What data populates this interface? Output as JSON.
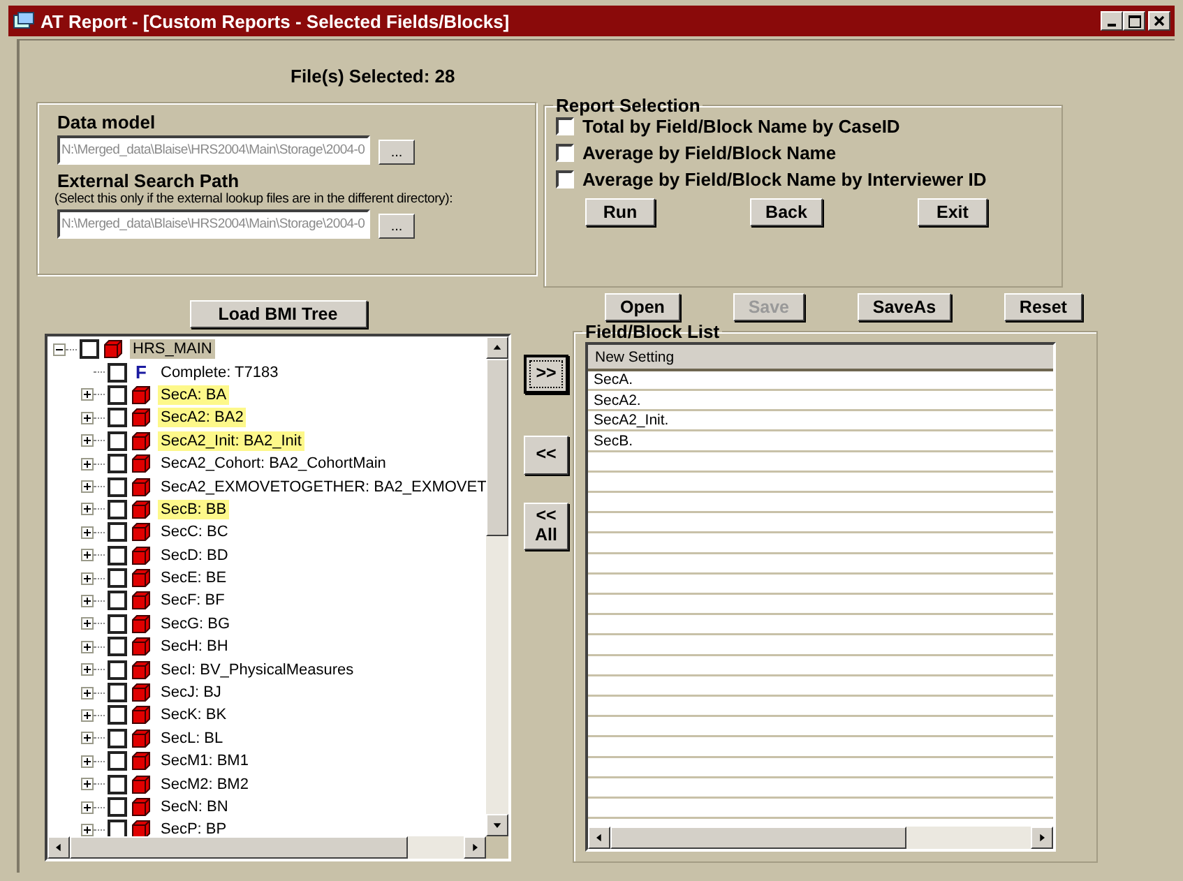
{
  "window": {
    "title": "AT Report - [Custom Reports - Selected Fields/Blocks]"
  },
  "files_selected": "File(s) Selected: 28",
  "data_model": {
    "label": "Data model",
    "value": "N:\\Merged_data\\Blaise\\HRS2004\\Main\\Storage\\2004-0",
    "browse": "..."
  },
  "external_search_path": {
    "label": "External Search Path",
    "note": "(Select this only if the external lookup files are in the different directory):",
    "value": "N:\\Merged_data\\Blaise\\HRS2004\\Main\\Storage\\2004-0",
    "browse": "..."
  },
  "report_selection": {
    "title": "Report Selection",
    "options": [
      {
        "label": "Total by Field/Block Name by CaseID",
        "checked": false
      },
      {
        "label": "Average by Field/Block Name",
        "checked": false
      },
      {
        "label": "Average by Field/Block Name by Interviewer ID",
        "checked": false
      }
    ],
    "buttons": [
      {
        "label": "Run",
        "disabled": false
      },
      {
        "label": "Back",
        "disabled": false
      },
      {
        "label": "Exit",
        "disabled": false
      }
    ]
  },
  "load_button": "Load BMI Tree",
  "tree": {
    "root": {
      "label": "HRS_MAIN",
      "kind": "block",
      "checked": false,
      "expanded": true,
      "selected": true,
      "highlighted": false,
      "children": [
        {
          "label": "Complete: T7183",
          "kind": "field",
          "glyph": "F",
          "checked": false,
          "selected": false,
          "highlighted": false
        },
        {
          "label": "SecA: BA",
          "kind": "block",
          "checked": false,
          "expanded": false,
          "selected": false,
          "highlighted": true
        },
        {
          "label": "SecA2: BA2",
          "kind": "block",
          "checked": false,
          "expanded": false,
          "selected": false,
          "highlighted": true
        },
        {
          "label": "SecA2_Init: BA2_Init",
          "kind": "block",
          "checked": false,
          "expanded": false,
          "selected": false,
          "highlighted": true
        },
        {
          "label": "SecA2_Cohort: BA2_CohortMain",
          "kind": "block",
          "checked": false,
          "expanded": false,
          "selected": false,
          "highlighted": false
        },
        {
          "label": "SecA2_EXMOVETOGETHER: BA2_EXMOVET",
          "kind": "block",
          "checked": false,
          "expanded": false,
          "selected": false,
          "highlighted": false
        },
        {
          "label": "SecB: BB",
          "kind": "block",
          "checked": false,
          "expanded": false,
          "selected": false,
          "highlighted": true
        },
        {
          "label": "SecC: BC",
          "kind": "block",
          "checked": false,
          "expanded": false,
          "selected": false,
          "highlighted": false
        },
        {
          "label": "SecD: BD",
          "kind": "block",
          "checked": false,
          "expanded": false,
          "selected": false,
          "highlighted": false
        },
        {
          "label": "SecE: BE",
          "kind": "block",
          "checked": false,
          "expanded": false,
          "selected": false,
          "highlighted": false
        },
        {
          "label": "SecF: BF",
          "kind": "block",
          "checked": false,
          "expanded": false,
          "selected": false,
          "highlighted": false
        },
        {
          "label": "SecG: BG",
          "kind": "block",
          "checked": false,
          "expanded": false,
          "selected": false,
          "highlighted": false
        },
        {
          "label": "SecH: BH",
          "kind": "block",
          "checked": false,
          "expanded": false,
          "selected": false,
          "highlighted": false
        },
        {
          "label": "SecI: BV_PhysicalMeasures",
          "kind": "block",
          "checked": false,
          "expanded": false,
          "selected": false,
          "highlighted": false
        },
        {
          "label": "SecJ: BJ",
          "kind": "block",
          "checked": false,
          "expanded": false,
          "selected": false,
          "highlighted": false
        },
        {
          "label": "SecK: BK",
          "kind": "block",
          "checked": false,
          "expanded": false,
          "selected": false,
          "highlighted": false
        },
        {
          "label": "SecL: BL",
          "kind": "block",
          "checked": false,
          "expanded": false,
          "selected": false,
          "highlighted": false
        },
        {
          "label": "SecM1: BM1",
          "kind": "block",
          "checked": false,
          "expanded": false,
          "selected": false,
          "highlighted": false
        },
        {
          "label": "SecM2: BM2",
          "kind": "block",
          "checked": false,
          "expanded": false,
          "selected": false,
          "highlighted": false
        },
        {
          "label": "SecN: BN",
          "kind": "block",
          "checked": false,
          "expanded": false,
          "selected": false,
          "highlighted": false
        },
        {
          "label": "SecP: BP",
          "kind": "block",
          "checked": false,
          "expanded": false,
          "selected": false,
          "highlighted": false
        }
      ]
    }
  },
  "transfer_buttons": [
    {
      "label": ">>",
      "focused": true
    },
    {
      "label": "<<",
      "focused": false
    },
    {
      "label": "<< All",
      "focused": false
    }
  ],
  "list_buttons": [
    {
      "label": "Open",
      "disabled": false
    },
    {
      "label": "Save",
      "disabled": true
    },
    {
      "label": "SaveAs",
      "disabled": false
    },
    {
      "label": "Reset",
      "disabled": false
    }
  ],
  "field_block_list": {
    "title": "Field/Block List",
    "header": "New Setting",
    "rows": [
      "SecA.",
      "SecA2.",
      "SecA2_Init.",
      "SecB."
    ]
  }
}
